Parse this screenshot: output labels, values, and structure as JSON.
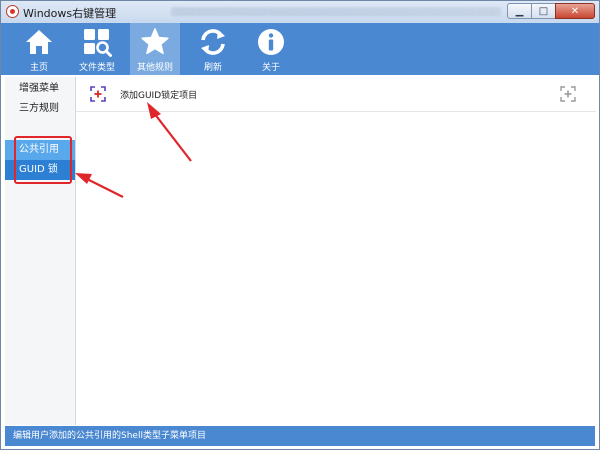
{
  "window": {
    "title": "Windows右键管理",
    "minimize_glyph": "▁",
    "maximize_glyph": "□",
    "close_glyph": "✕"
  },
  "toolbar": {
    "items": [
      {
        "label": "主页",
        "icon": "home-icon"
      },
      {
        "label": "文件类型",
        "icon": "file-type-icon"
      },
      {
        "label": "其他规则",
        "icon": "star-icon",
        "active": true
      },
      {
        "label": "刷新",
        "icon": "refresh-icon"
      },
      {
        "label": "关于",
        "icon": "info-icon"
      }
    ]
  },
  "sidebar": {
    "items": [
      {
        "label": "增强菜单"
      },
      {
        "label": "三方规则"
      },
      {
        "label": "公共引用",
        "selected": true
      },
      {
        "label": "GUID 锁",
        "selected": true
      }
    ]
  },
  "content": {
    "add_label": "添加GUID锁定项目"
  },
  "status": {
    "text": "编辑用户添加的公共引用的Shell类型子菜单项目"
  },
  "colors": {
    "toolbar": "#4a88d1",
    "toolbar_active": "#7aaae0",
    "sidebar_selected_light": "#5aa8ec",
    "sidebar_selected_dark": "#2d7fd4",
    "annotation_red": "#e0262b"
  }
}
